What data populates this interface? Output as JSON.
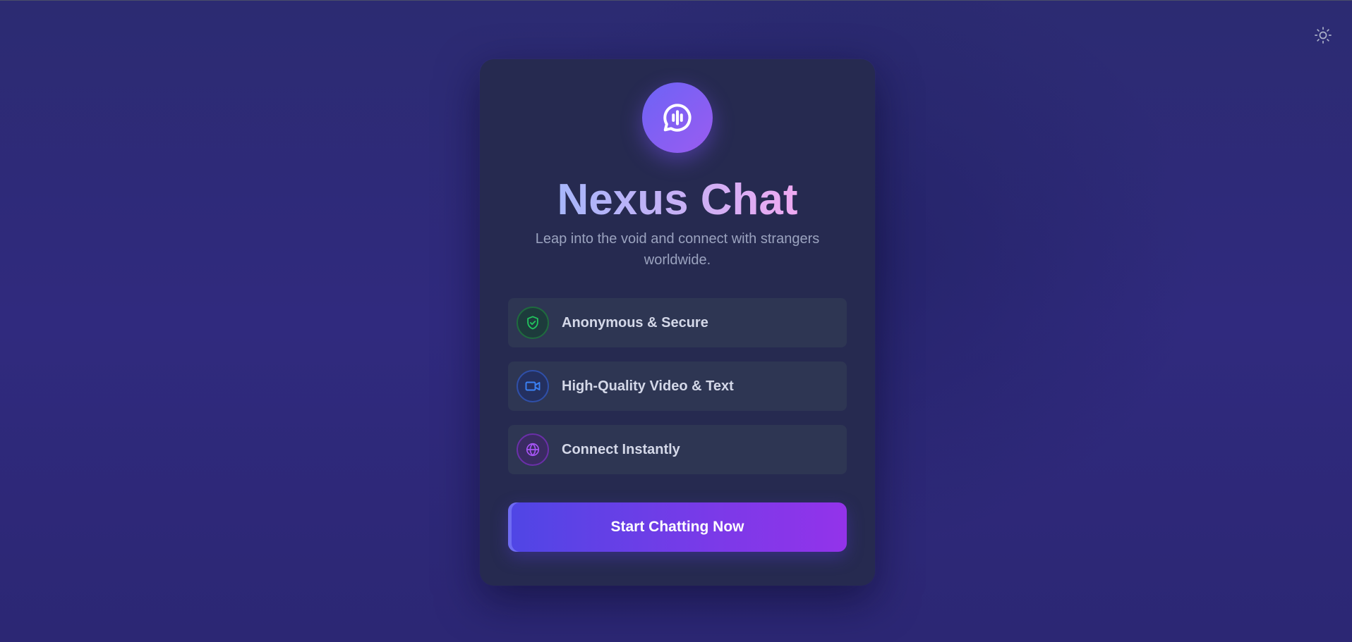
{
  "app": {
    "title": "Nexus Chat",
    "subtitle": "Leap into the void and connect with strangers worldwide."
  },
  "header": {
    "theme_toggle_icon": "sun-icon"
  },
  "logo": {
    "icon": "chat-audio-bubble-icon"
  },
  "features": [
    {
      "label": "Anonymous & Secure",
      "icon": "shield-check-icon",
      "color": "#22c55e"
    },
    {
      "label": "High-Quality Video & Text",
      "icon": "video-camera-icon",
      "color": "#3b82f6"
    },
    {
      "label": "Connect Instantly",
      "icon": "globe-icon",
      "color": "#a855f7"
    }
  ],
  "cta": {
    "label": "Start Chatting Now"
  },
  "colors": {
    "accent_start": "#4f46e5",
    "accent_end": "#9333ea",
    "card_bg": "#262a50",
    "page_bg": "#2e2a78"
  }
}
